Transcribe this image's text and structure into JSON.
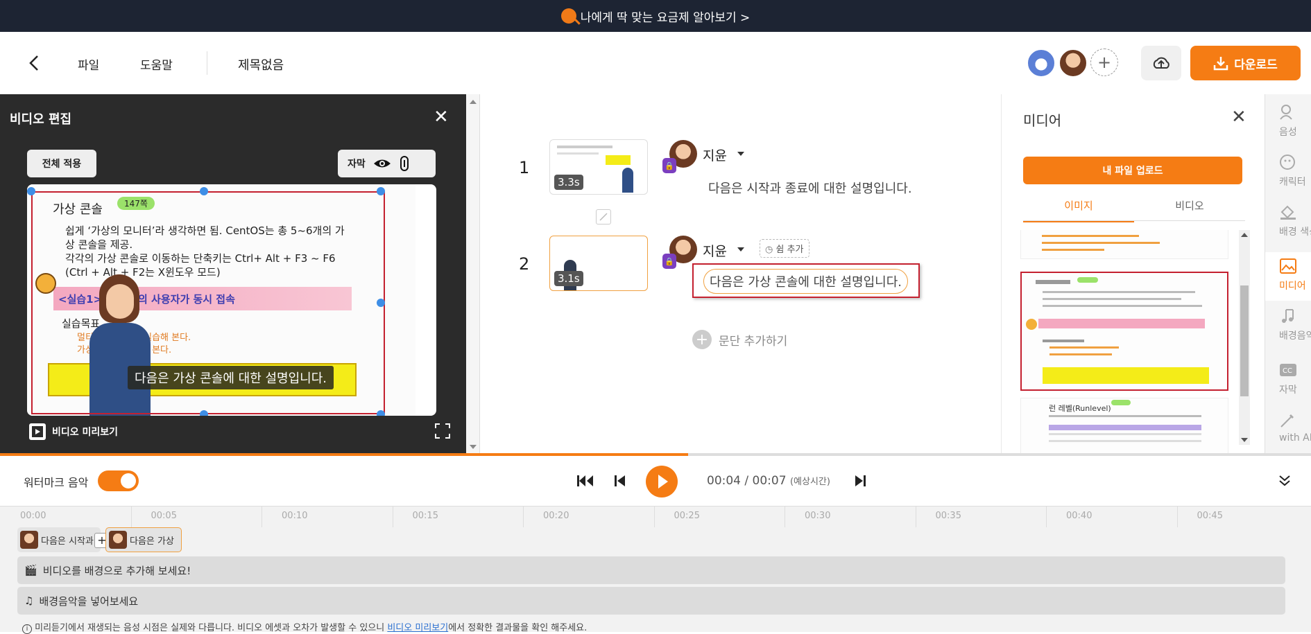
{
  "promo": {
    "text": "나에게 딱 맞는 요금제 알아보기 >"
  },
  "header": {
    "menu_file": "파일",
    "menu_help": "도움말",
    "doc_title": "제목없음",
    "add_person": "+",
    "download_label": "다운로드"
  },
  "left_panel": {
    "title": "비디오 편집",
    "apply_all": "전체 적용",
    "subtitle_label": "자막",
    "video_preview_label": "비디오 미리보기",
    "slide": {
      "title": "가상 콘솔",
      "page_badge": "147쪽",
      "bullet1": "쉽게 ‘가상의 모니터’라 생각하면 됨. CentOS는 총 5~6개의 가",
      "bullet1b": "상 콘솔을 제공.",
      "bullet2": "각각의 가상 콘솔로 이동하는 단축키는 Ctrl+ Alt + F3 ~ F6",
      "bullet2b": "(Ctrl + Alt + F2는 X윈도우 모드)",
      "practice": "<실습1> 여러 명의 사용자가 동시 접속",
      "goal": "실습목표",
      "goal1": "멀티 유저 환경을 실습해 본다.",
      "goal2": "가상 콘솔을 실습해 본다."
    },
    "caption": "다음은 가상 콘솔에 대한 설명입니다."
  },
  "script": {
    "items": [
      {
        "num": "1",
        "duration": "3.3s",
        "speaker": "지윤",
        "text": "다음은 시작과 종료에 대한 설명입니다."
      },
      {
        "num": "2",
        "duration": "3.1s",
        "speaker": "지윤",
        "text": "다음은 가상 콘솔에 대한 설명입니다."
      }
    ],
    "pause_add": "쉼 추가",
    "add_paragraph": "문단 추가하기"
  },
  "media": {
    "title": "미디어",
    "upload": "내 파일 업로드",
    "tab_image": "이미지",
    "tab_video": "비디오",
    "thumb3_title": "런 레벨(Runlevel)"
  },
  "rail": {
    "items": [
      "음성",
      "캐릭터",
      "배경 색상",
      "미디어",
      "배경음악",
      "자막",
      "with AI"
    ]
  },
  "playback": {
    "watermark_label": "워터마크 음악",
    "current": "00:04",
    "total": "00:07",
    "estimate": "(예상시간)",
    "progress": 0.525
  },
  "timeline": {
    "ticks": [
      "00:00",
      "00:05",
      "00:10",
      "00:15",
      "00:20",
      "00:25",
      "00:30",
      "00:35",
      "00:40",
      "00:45"
    ],
    "clip1": "다음은 시작과",
    "clip2": "다음은 가상",
    "video_track": "비디오를 배경으로 추가해 보세요!",
    "music_track": "배경음악을 넣어보세요",
    "notice_pre": "미리듣기에서 재생되는 음성 시점은 실제와 다릅니다. 비디오 에셋과 오차가 발생할 수 있으니 ",
    "notice_link": "비디오 미리보기",
    "notice_post": "에서 정확한 결과물을 확인 해주세요."
  },
  "colors": {
    "accent": "#f57c14",
    "dark": "#2b2b2b",
    "selection": "#c4202f",
    "handle": "#3e8ee6"
  }
}
